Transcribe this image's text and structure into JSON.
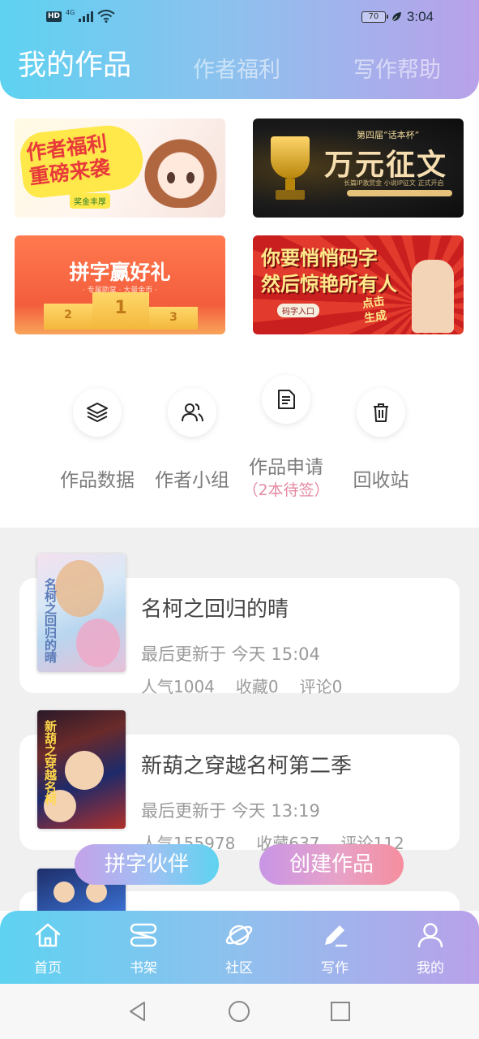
{
  "status_bar": {
    "hd": "HD",
    "network": "4G",
    "battery": "70",
    "time": "3:04"
  },
  "tabs": [
    {
      "label": "我的作品",
      "active": true
    },
    {
      "label": "作者福利",
      "active": false
    },
    {
      "label": "写作帮助",
      "active": false
    }
  ],
  "banners": [
    {
      "title_line1": "作者福利",
      "title_line2": "重磅来袭",
      "chip": "奖金丰厚"
    },
    {
      "subtitle": "第四届“话本杯”",
      "title": "万元征文",
      "line": "长篇IP激赏金 小说IP征文 正式开启"
    },
    {
      "title": "拼字赢好礼",
      "subtitle": "· 专属助掌 · 大量金币 ·",
      "podium": [
        "2",
        "1",
        "3"
      ]
    },
    {
      "title_line1": "你要悄悄码字",
      "title_line2": "然后惊艳所有人",
      "chip": "码字入口",
      "cta_line1": "点击",
      "cta_line2": "生成"
    }
  ],
  "actions": [
    {
      "label": "作品数据",
      "icon": "layers-icon"
    },
    {
      "label": "作者小组",
      "icon": "group-icon"
    },
    {
      "label": "作品申请",
      "icon": "document-icon",
      "note": "（2本待签）"
    },
    {
      "label": "回收站",
      "icon": "trash-icon"
    }
  ],
  "works": [
    {
      "title": "名柯之回归的晴",
      "updated": "最后更新于 今天 15:04",
      "popularity": "人气1004",
      "favorites": "收藏0",
      "comments": "评论0",
      "cover_text": "名柯之回归的晴"
    },
    {
      "title": "新葫之穿越名柯第二季",
      "updated": "最后更新于 今天 13:19",
      "popularity": "人气155978",
      "favorites": "收藏637",
      "comments": "评论112",
      "cover_text": "新葫之穿越名柯"
    }
  ],
  "floating_buttons": {
    "partner": "拼字伙伴",
    "create": "创建作品"
  },
  "bottom_nav": [
    {
      "label": "首页",
      "icon": "home-icon"
    },
    {
      "label": "书架",
      "icon": "bookshelf-icon"
    },
    {
      "label": "社区",
      "icon": "planet-icon"
    },
    {
      "label": "写作",
      "icon": "pen-icon",
      "active": true
    },
    {
      "label": "我的",
      "icon": "user-icon"
    }
  ],
  "colors": {
    "header_gradient_start": "#5ed2f1",
    "header_gradient_end": "#b9a1e9",
    "note_pink": "#e48aa2",
    "list_background": "#f0f0f0"
  }
}
